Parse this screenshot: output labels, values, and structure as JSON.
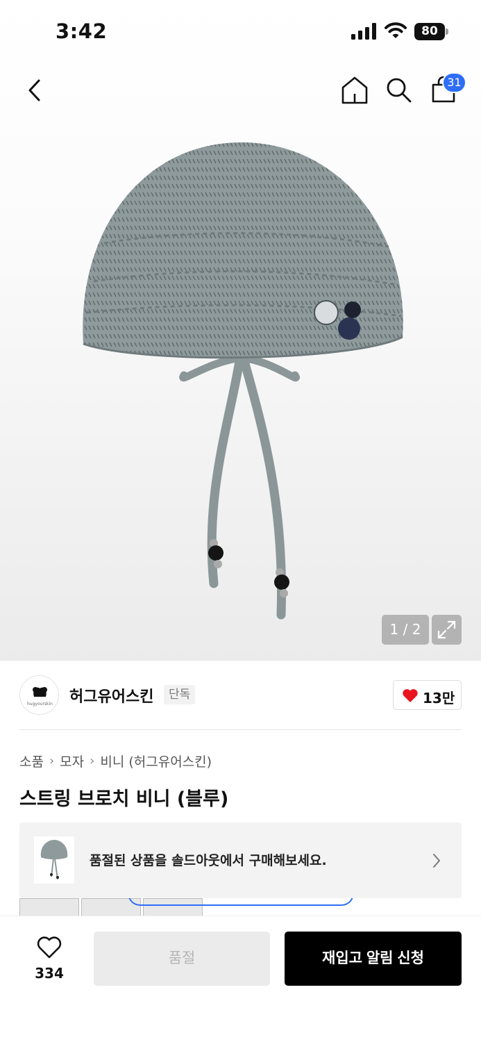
{
  "status_bar": {
    "time": "3:42",
    "battery": "80"
  },
  "header": {
    "cart_count": "31"
  },
  "gallery": {
    "counter": "1 / 2"
  },
  "brand": {
    "name": "허그유어스킨",
    "tag": "단독",
    "logo_text": "hugyourskin",
    "likes": "13만"
  },
  "breadcrumb": [
    "소품",
    "모자",
    "비니 (허그유어스킨)"
  ],
  "product": {
    "title": "스트링 브로치 비니 (블루)"
  },
  "soldout_banner": {
    "text": "품절된 상품을 솔드아웃에서 구매해보세요."
  },
  "bottom_bar": {
    "wish_count": "334",
    "soldout_label": "품절",
    "restock_label": "재입고 알림 신청"
  },
  "colors": {
    "accent": "#2e6ef7",
    "heart": "#e8141f",
    "primary_button": "#000000",
    "disabled_button": "#ebebeb"
  },
  "icons": [
    "back-icon",
    "home-icon",
    "search-icon",
    "shopping-bag-icon",
    "expand-icon",
    "heart-icon",
    "chevron-right-icon"
  ]
}
